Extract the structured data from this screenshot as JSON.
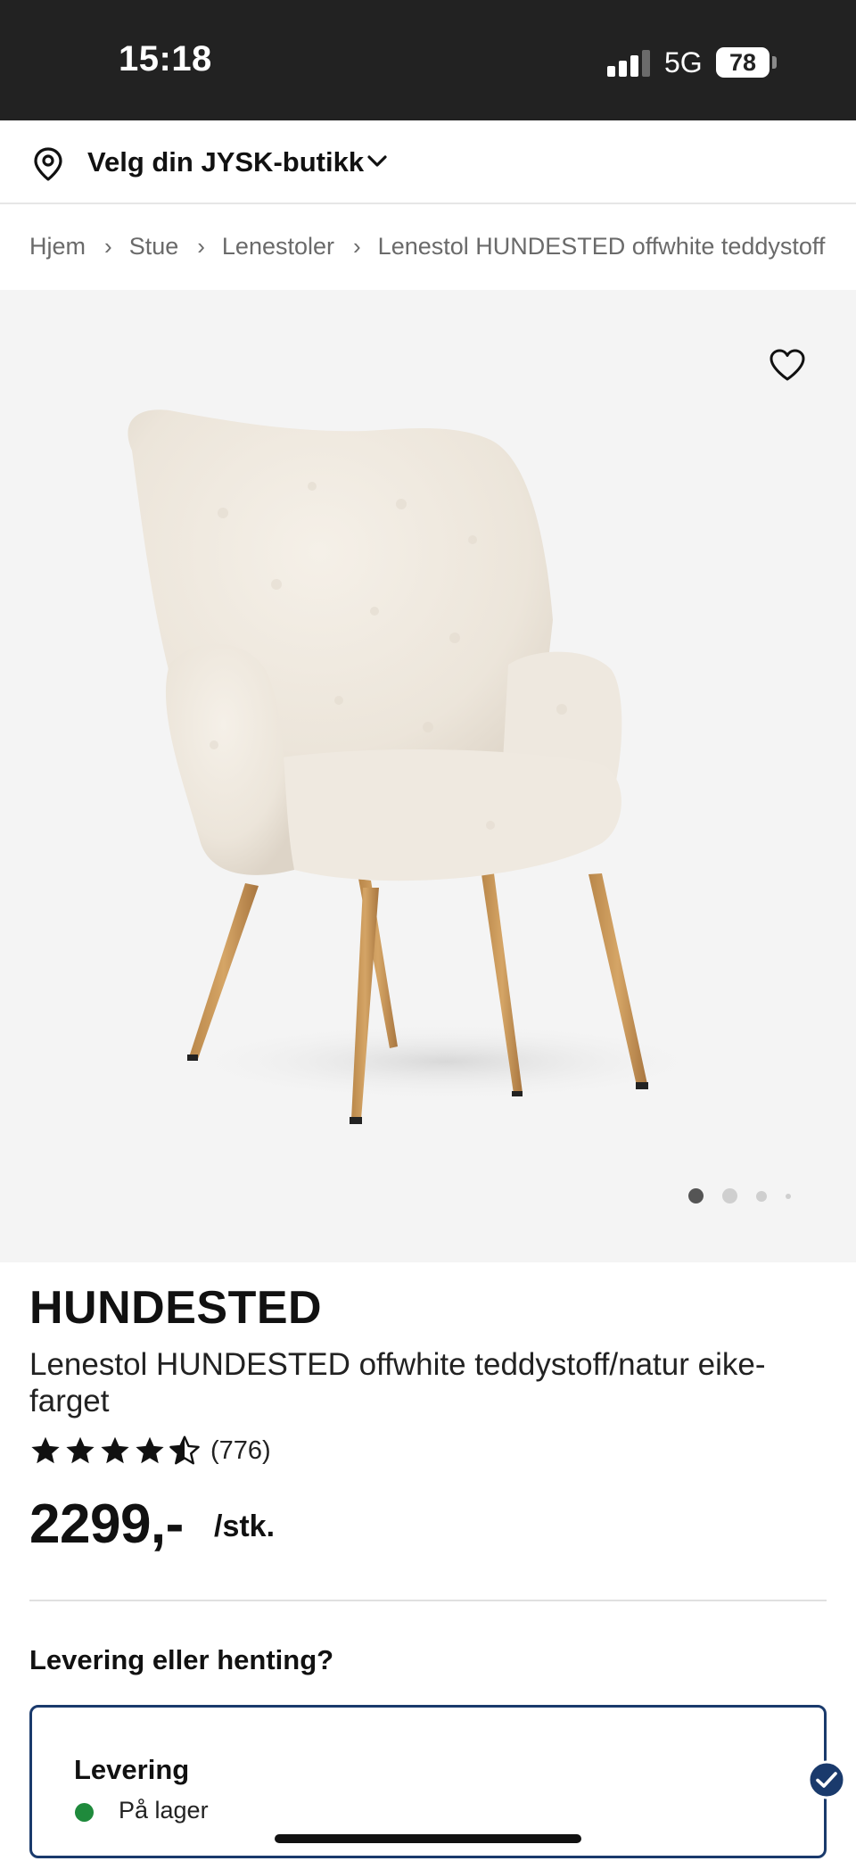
{
  "status_bar": {
    "time": "15:18",
    "network": "5G",
    "battery": "78"
  },
  "store_selector": {
    "label": "Velg din JYSK-butikk",
    "icon": "location-pin-icon"
  },
  "breadcrumb": {
    "items": [
      "Hjem",
      "Stue",
      "Lenestoler",
      "Lenestol HUNDESTED offwhite teddystoff"
    ]
  },
  "gallery": {
    "image_count": 4,
    "active_index": 0
  },
  "product": {
    "brand": "HUNDESTED",
    "name": "Lenestol HUNDESTED offwhite teddystoff/natur eike-farget",
    "rating": 4.5,
    "review_count": "(776)",
    "price": "2299,-",
    "unit": "/stk."
  },
  "delivery": {
    "heading": "Levering eller henting?",
    "option_title": "Levering",
    "stock_status": "På lager",
    "stock_color": "#1f8a3c",
    "accent_color": "#1a3a6c"
  }
}
